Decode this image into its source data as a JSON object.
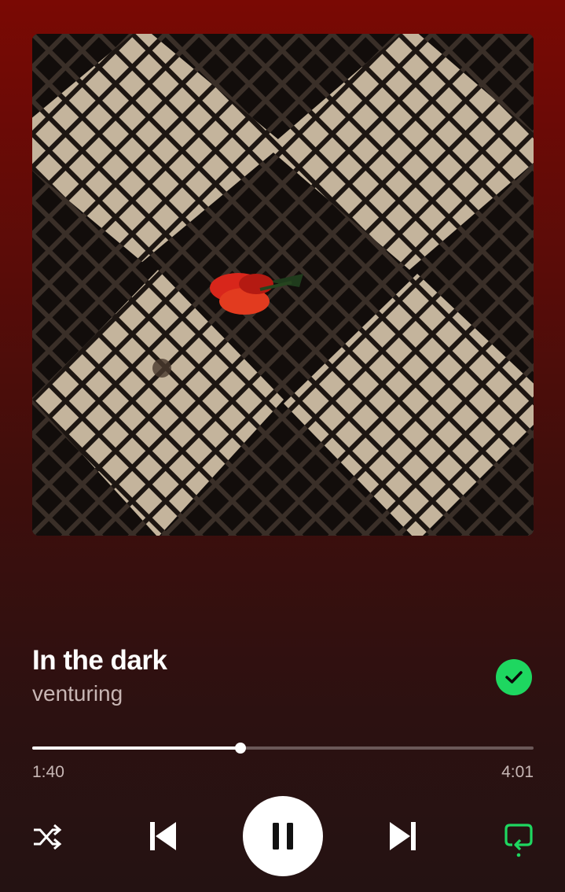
{
  "track": {
    "title": "In the dark",
    "artist": "venturing",
    "liked": true
  },
  "playback": {
    "elapsed": "1:40",
    "duration": "4:01",
    "progress_fraction": 0.415,
    "state": "playing"
  },
  "controls": {
    "shuffle_icon": "shuffle-icon",
    "previous_icon": "skip-previous-icon",
    "pause_icon": "pause-icon",
    "next_icon": "skip-next-icon",
    "repeat_icon": "repeat-icon",
    "repeat_active": true
  },
  "colors": {
    "accent_green": "#1ed760",
    "background_top": "#7a0904",
    "background_bottom": "#241212"
  },
  "album_art": {
    "icon": "album-cover-image"
  }
}
